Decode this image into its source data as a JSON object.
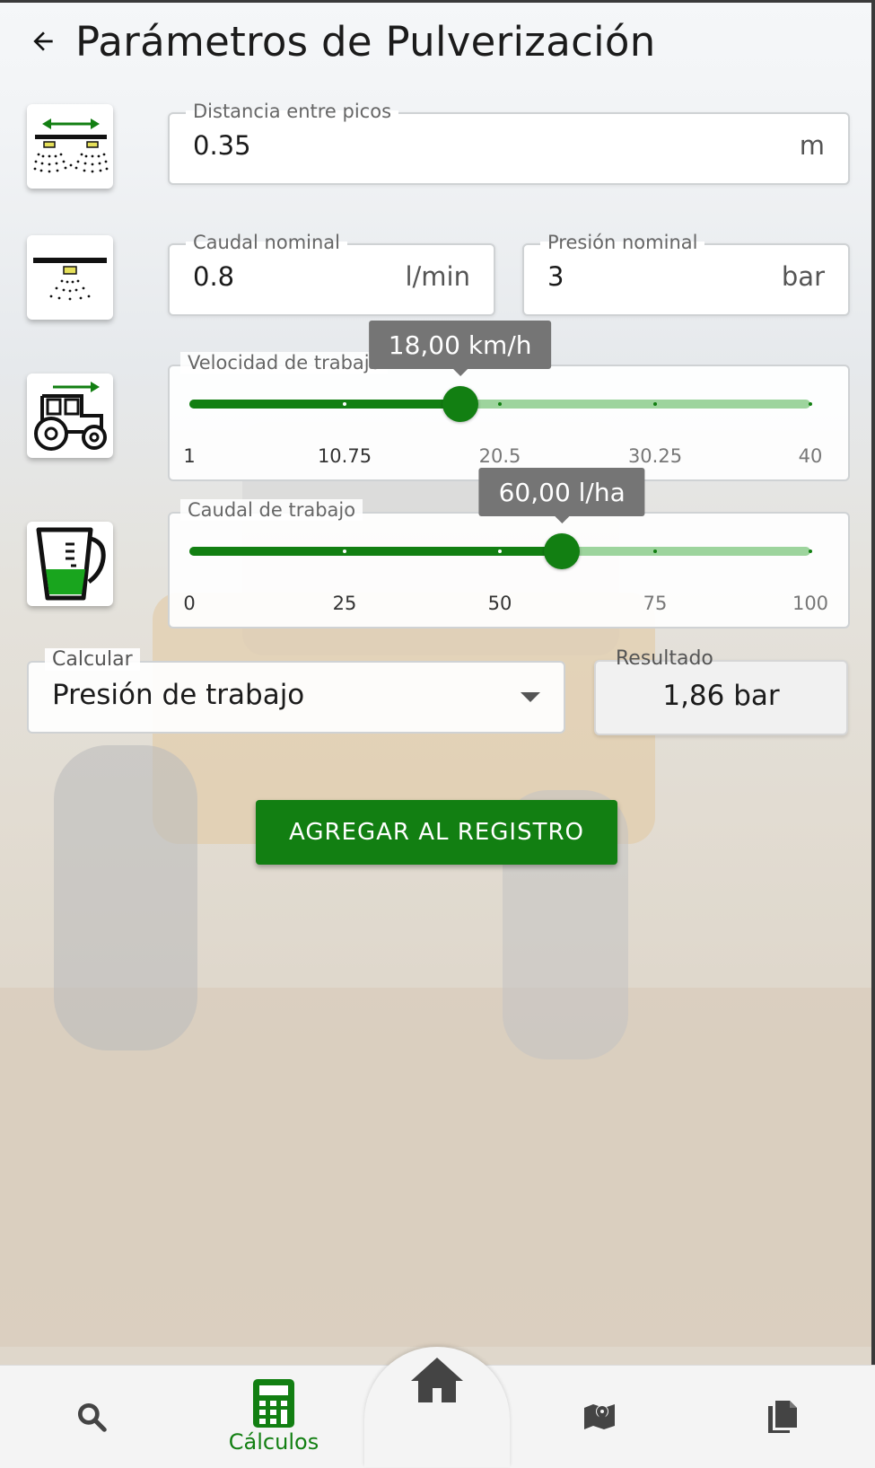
{
  "header": {
    "title": "Parámetros de Pulverización"
  },
  "nozzle_spacing": {
    "label": "Distancia entre picos",
    "value": "0.35",
    "unit": "m"
  },
  "nominal_flow": {
    "label": "Caudal nominal",
    "value": "0.8",
    "unit": "l/min"
  },
  "nominal_pressure": {
    "label": "Presión nominal",
    "value": "3",
    "unit": "bar"
  },
  "work_speed": {
    "label": "Velocidad de trabajo",
    "tooltip": "18,00 km/h",
    "min": 1,
    "max": 40,
    "value": 18,
    "ticks": [
      "1",
      "10.75",
      "20.5",
      "30.25",
      "40"
    ]
  },
  "work_flow": {
    "label": "Caudal de trabajo",
    "tooltip": "60,00 l/ha",
    "min": 0,
    "max": 100,
    "value": 60,
    "ticks": [
      "0",
      "25",
      "50",
      "75",
      "100"
    ]
  },
  "calculate": {
    "label": "Calcular",
    "selected": "Presión de trabajo"
  },
  "result": {
    "label": "Resultado",
    "value": "1,86 bar"
  },
  "add_button": {
    "label": "AGREGAR AL REGISTRO"
  },
  "bottom_nav": {
    "items": [
      {
        "id": "search",
        "icon": "search-icon"
      },
      {
        "id": "calculos",
        "icon": "calculator-icon",
        "label": "Cálculos",
        "active": true
      },
      {
        "id": "home",
        "icon": "home-icon"
      },
      {
        "id": "map",
        "icon": "map-icon"
      },
      {
        "id": "documents",
        "icon": "documents-icon"
      }
    ]
  },
  "colors": {
    "primary": "#127f12",
    "track_light": "#9dd49d",
    "tooltip": "#757575"
  }
}
